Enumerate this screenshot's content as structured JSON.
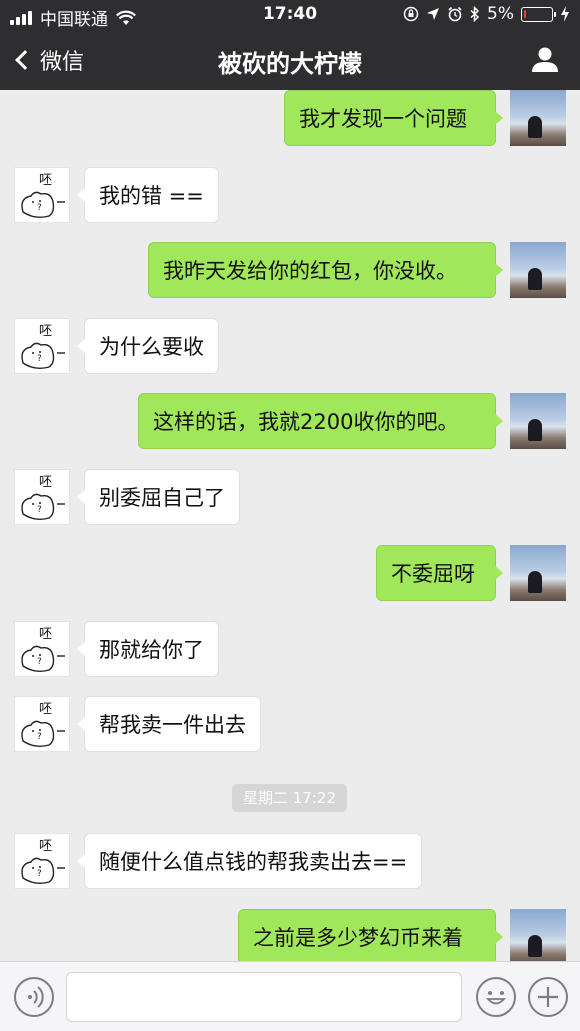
{
  "status_bar": {
    "carrier": "中国联通",
    "time": "17:40",
    "battery_percent": "5%",
    "battery_level": 0.05,
    "icons": [
      "signal-icon",
      "wifi-icon",
      "orientation-lock-icon",
      "location-icon",
      "alarm-icon",
      "bluetooth-icon",
      "battery-icon",
      "charging-icon"
    ]
  },
  "nav": {
    "back_label": "微信",
    "title": "被砍的大柠檬",
    "profile_icon": "person-icon"
  },
  "messages": [
    {
      "sender": "me",
      "text": "我才发现一个问题"
    },
    {
      "sender": "them",
      "text": "我的错 =="
    },
    {
      "sender": "me",
      "text": "我昨天发给你的红包，你没收。"
    },
    {
      "sender": "them",
      "text": "为什么要收"
    },
    {
      "sender": "me",
      "text": "这样的话，我就2200收你的吧。"
    },
    {
      "sender": "them",
      "text": "别委屈自己了"
    },
    {
      "sender": "me",
      "text": "不委屈呀"
    },
    {
      "sender": "them",
      "text": "那就给你了"
    },
    {
      "sender": "them",
      "text": "帮我卖一件出去"
    },
    {
      "type": "timestamp",
      "text": "星期二 17:22"
    },
    {
      "sender": "them",
      "text": "随便什么值点钱的帮我卖出去=="
    },
    {
      "sender": "me",
      "text": "之前是多少梦幻币来着"
    }
  ],
  "avatar_sticker_text": "呸",
  "avatar_sticker_mark": "?",
  "input": {
    "value": "",
    "placeholder": ""
  },
  "colors": {
    "bar_background": "#2e2e31",
    "chat_background": "#ececec",
    "my_bubble": "#a0e75a",
    "their_bubble": "#ffffff",
    "timestamp_background": "#d6d6d6"
  }
}
